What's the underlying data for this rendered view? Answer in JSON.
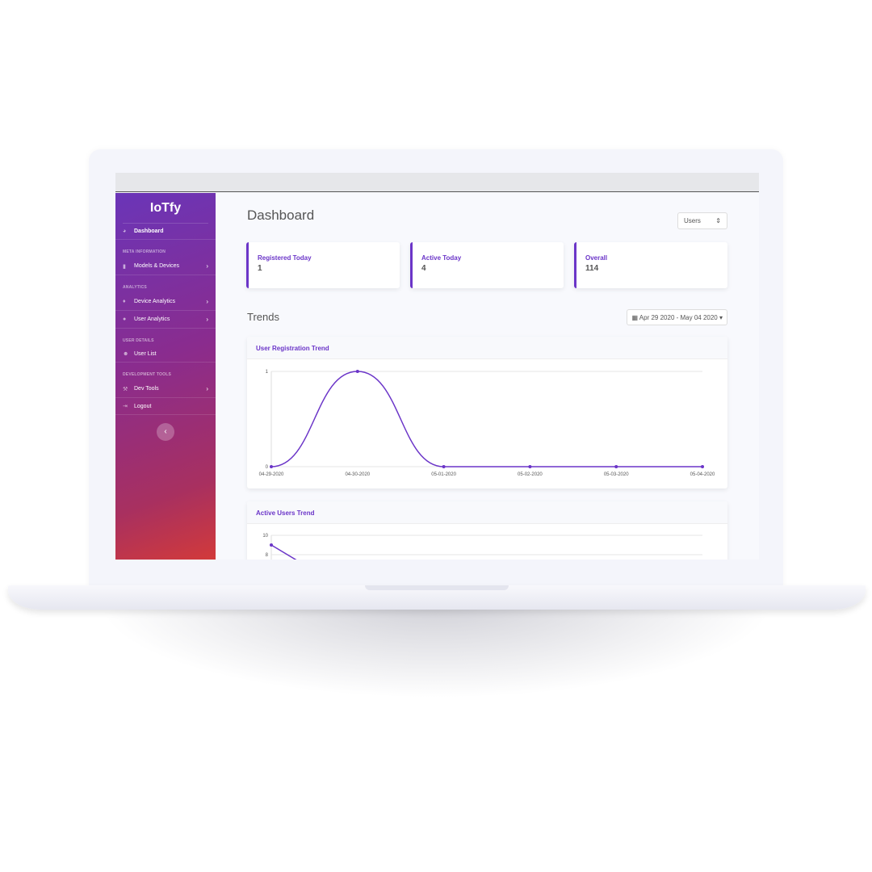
{
  "sidebar": {
    "logo": "IoTfy",
    "items": [
      {
        "label": "Dashboard",
        "icon": "dashboard-icon"
      },
      {
        "section": "META INFORMATION"
      },
      {
        "label": "Models & Devices",
        "icon": "device-icon",
        "chevron": true
      },
      {
        "section": "ANALYTICS"
      },
      {
        "label": "Device Analytics",
        "icon": "bulb-icon",
        "chevron": true
      },
      {
        "label": "User Analytics",
        "icon": "user-icon",
        "chevron": true
      },
      {
        "section": "USER DETAILS"
      },
      {
        "label": "User List",
        "icon": "users-icon"
      },
      {
        "section": "DEVELOPMENT TOOLS"
      },
      {
        "label": "Dev Tools",
        "icon": "tools-icon",
        "chevron": true
      },
      {
        "label": "Logout",
        "icon": "logout-icon"
      }
    ]
  },
  "header": {
    "title": "Dashboard",
    "select": "Users"
  },
  "stats": [
    {
      "label": "Registered Today",
      "value": "1"
    },
    {
      "label": "Active Today",
      "value": "4"
    },
    {
      "label": "Overall",
      "value": "114"
    }
  ],
  "trends": {
    "title": "Trends",
    "date_range": "Apr 29 2020 - May 04 2020"
  },
  "accent": "#6b35c8",
  "chart_data": [
    {
      "type": "line",
      "title": "User Registration Trend",
      "categories": [
        "04-29-2020",
        "04-30-2020",
        "05-01-2020",
        "05-02-2020",
        "05-03-2020",
        "05-04-2020"
      ],
      "values": [
        0,
        1,
        0,
        0,
        0,
        0
      ],
      "ylim": [
        0,
        1
      ],
      "yticks": [
        "0",
        "1"
      ]
    },
    {
      "type": "line",
      "title": "Active Users Trend",
      "yticks": [
        "8",
        "10"
      ],
      "values": [
        9
      ],
      "ylim": [
        8,
        10
      ]
    }
  ]
}
